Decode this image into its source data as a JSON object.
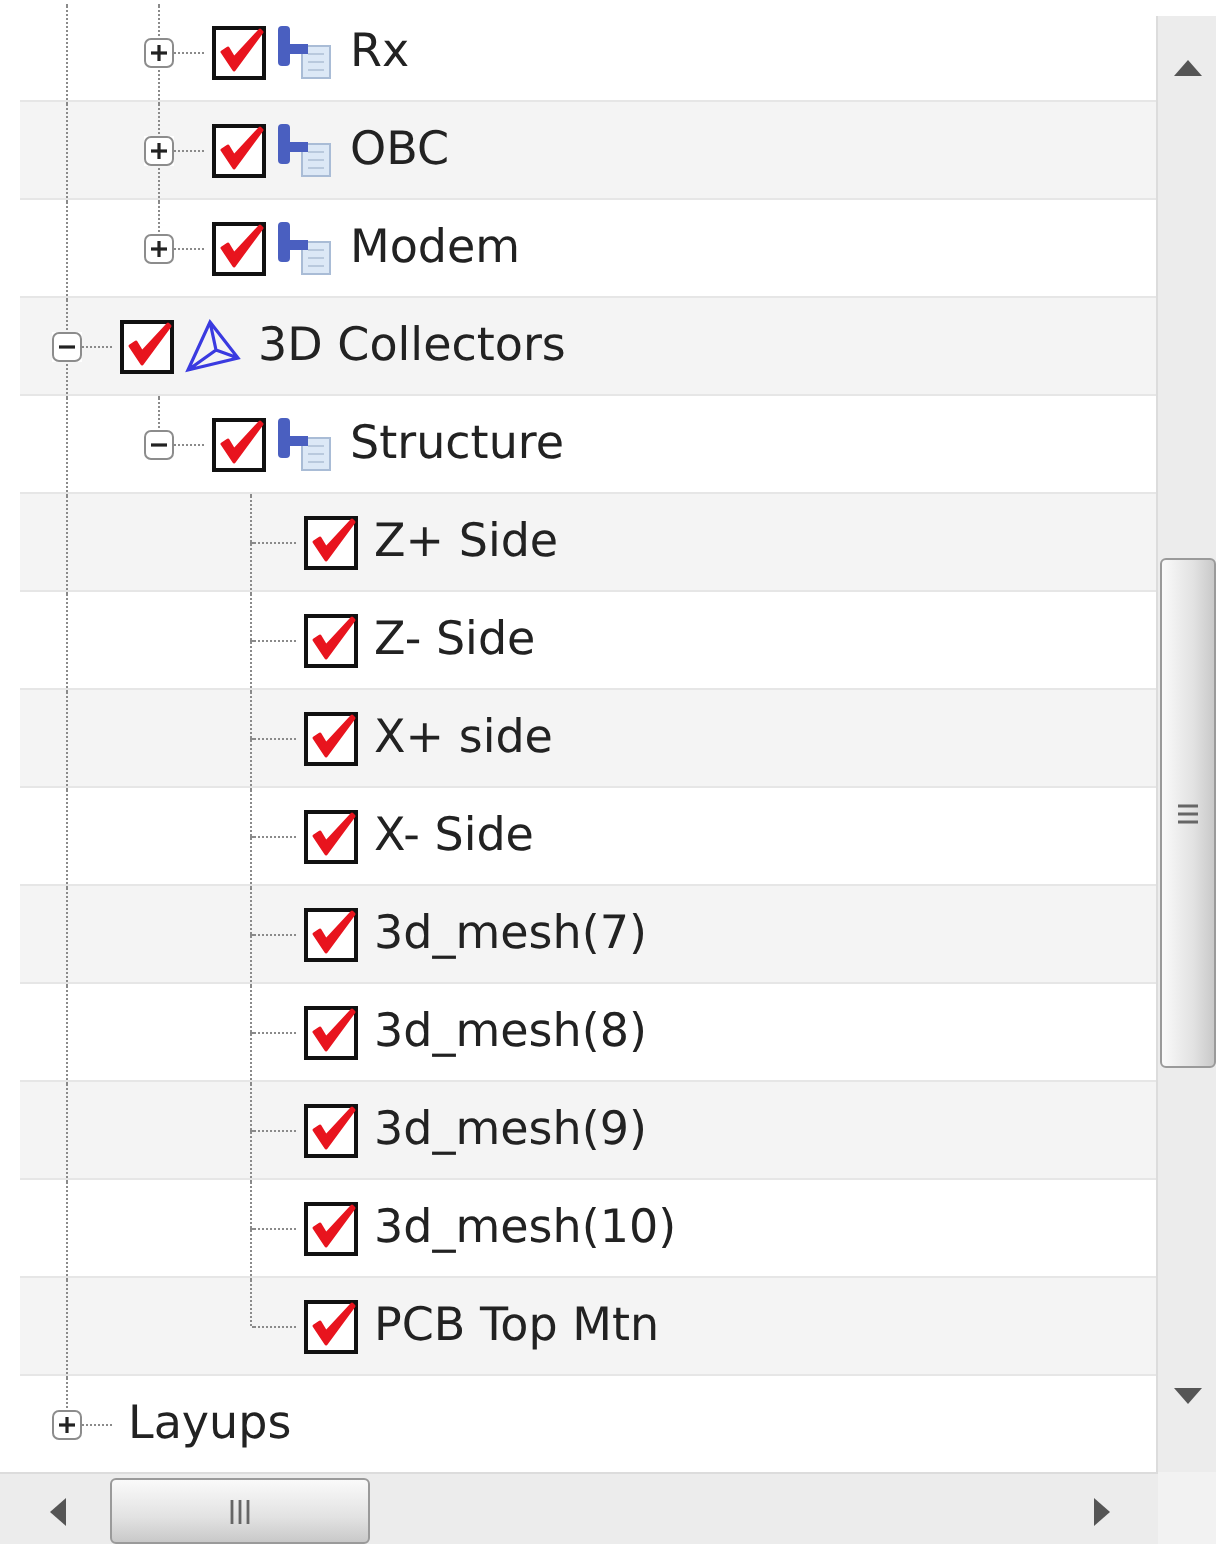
{
  "tree": {
    "continued_children": [
      {
        "label": "Rx",
        "kind": "group",
        "checked": true,
        "expanded": false
      },
      {
        "label": "OBC",
        "kind": "group",
        "checked": true,
        "expanded": false
      },
      {
        "label": "Modem",
        "kind": "group",
        "checked": true,
        "expanded": false
      }
    ],
    "items": [
      {
        "label": "3D Collectors",
        "kind": "collector",
        "checked": true,
        "expanded": true,
        "children": [
          {
            "label": "Structure",
            "kind": "group",
            "checked": true,
            "expanded": true,
            "children": [
              {
                "label": "Z+ Side",
                "checked": true
              },
              {
                "label": "Z- Side",
                "checked": true
              },
              {
                "label": "X+ side",
                "checked": true
              },
              {
                "label": "X- Side",
                "checked": true
              },
              {
                "label": "3d_mesh(7)",
                "checked": true
              },
              {
                "label": "3d_mesh(8)",
                "checked": true
              },
              {
                "label": "3d_mesh(9)",
                "checked": true
              },
              {
                "label": "3d_mesh(10)",
                "checked": true
              },
              {
                "label": "PCB Top Mtn",
                "checked": true
              }
            ]
          }
        ]
      },
      {
        "label": "Layups",
        "expanded": false
      }
    ]
  }
}
